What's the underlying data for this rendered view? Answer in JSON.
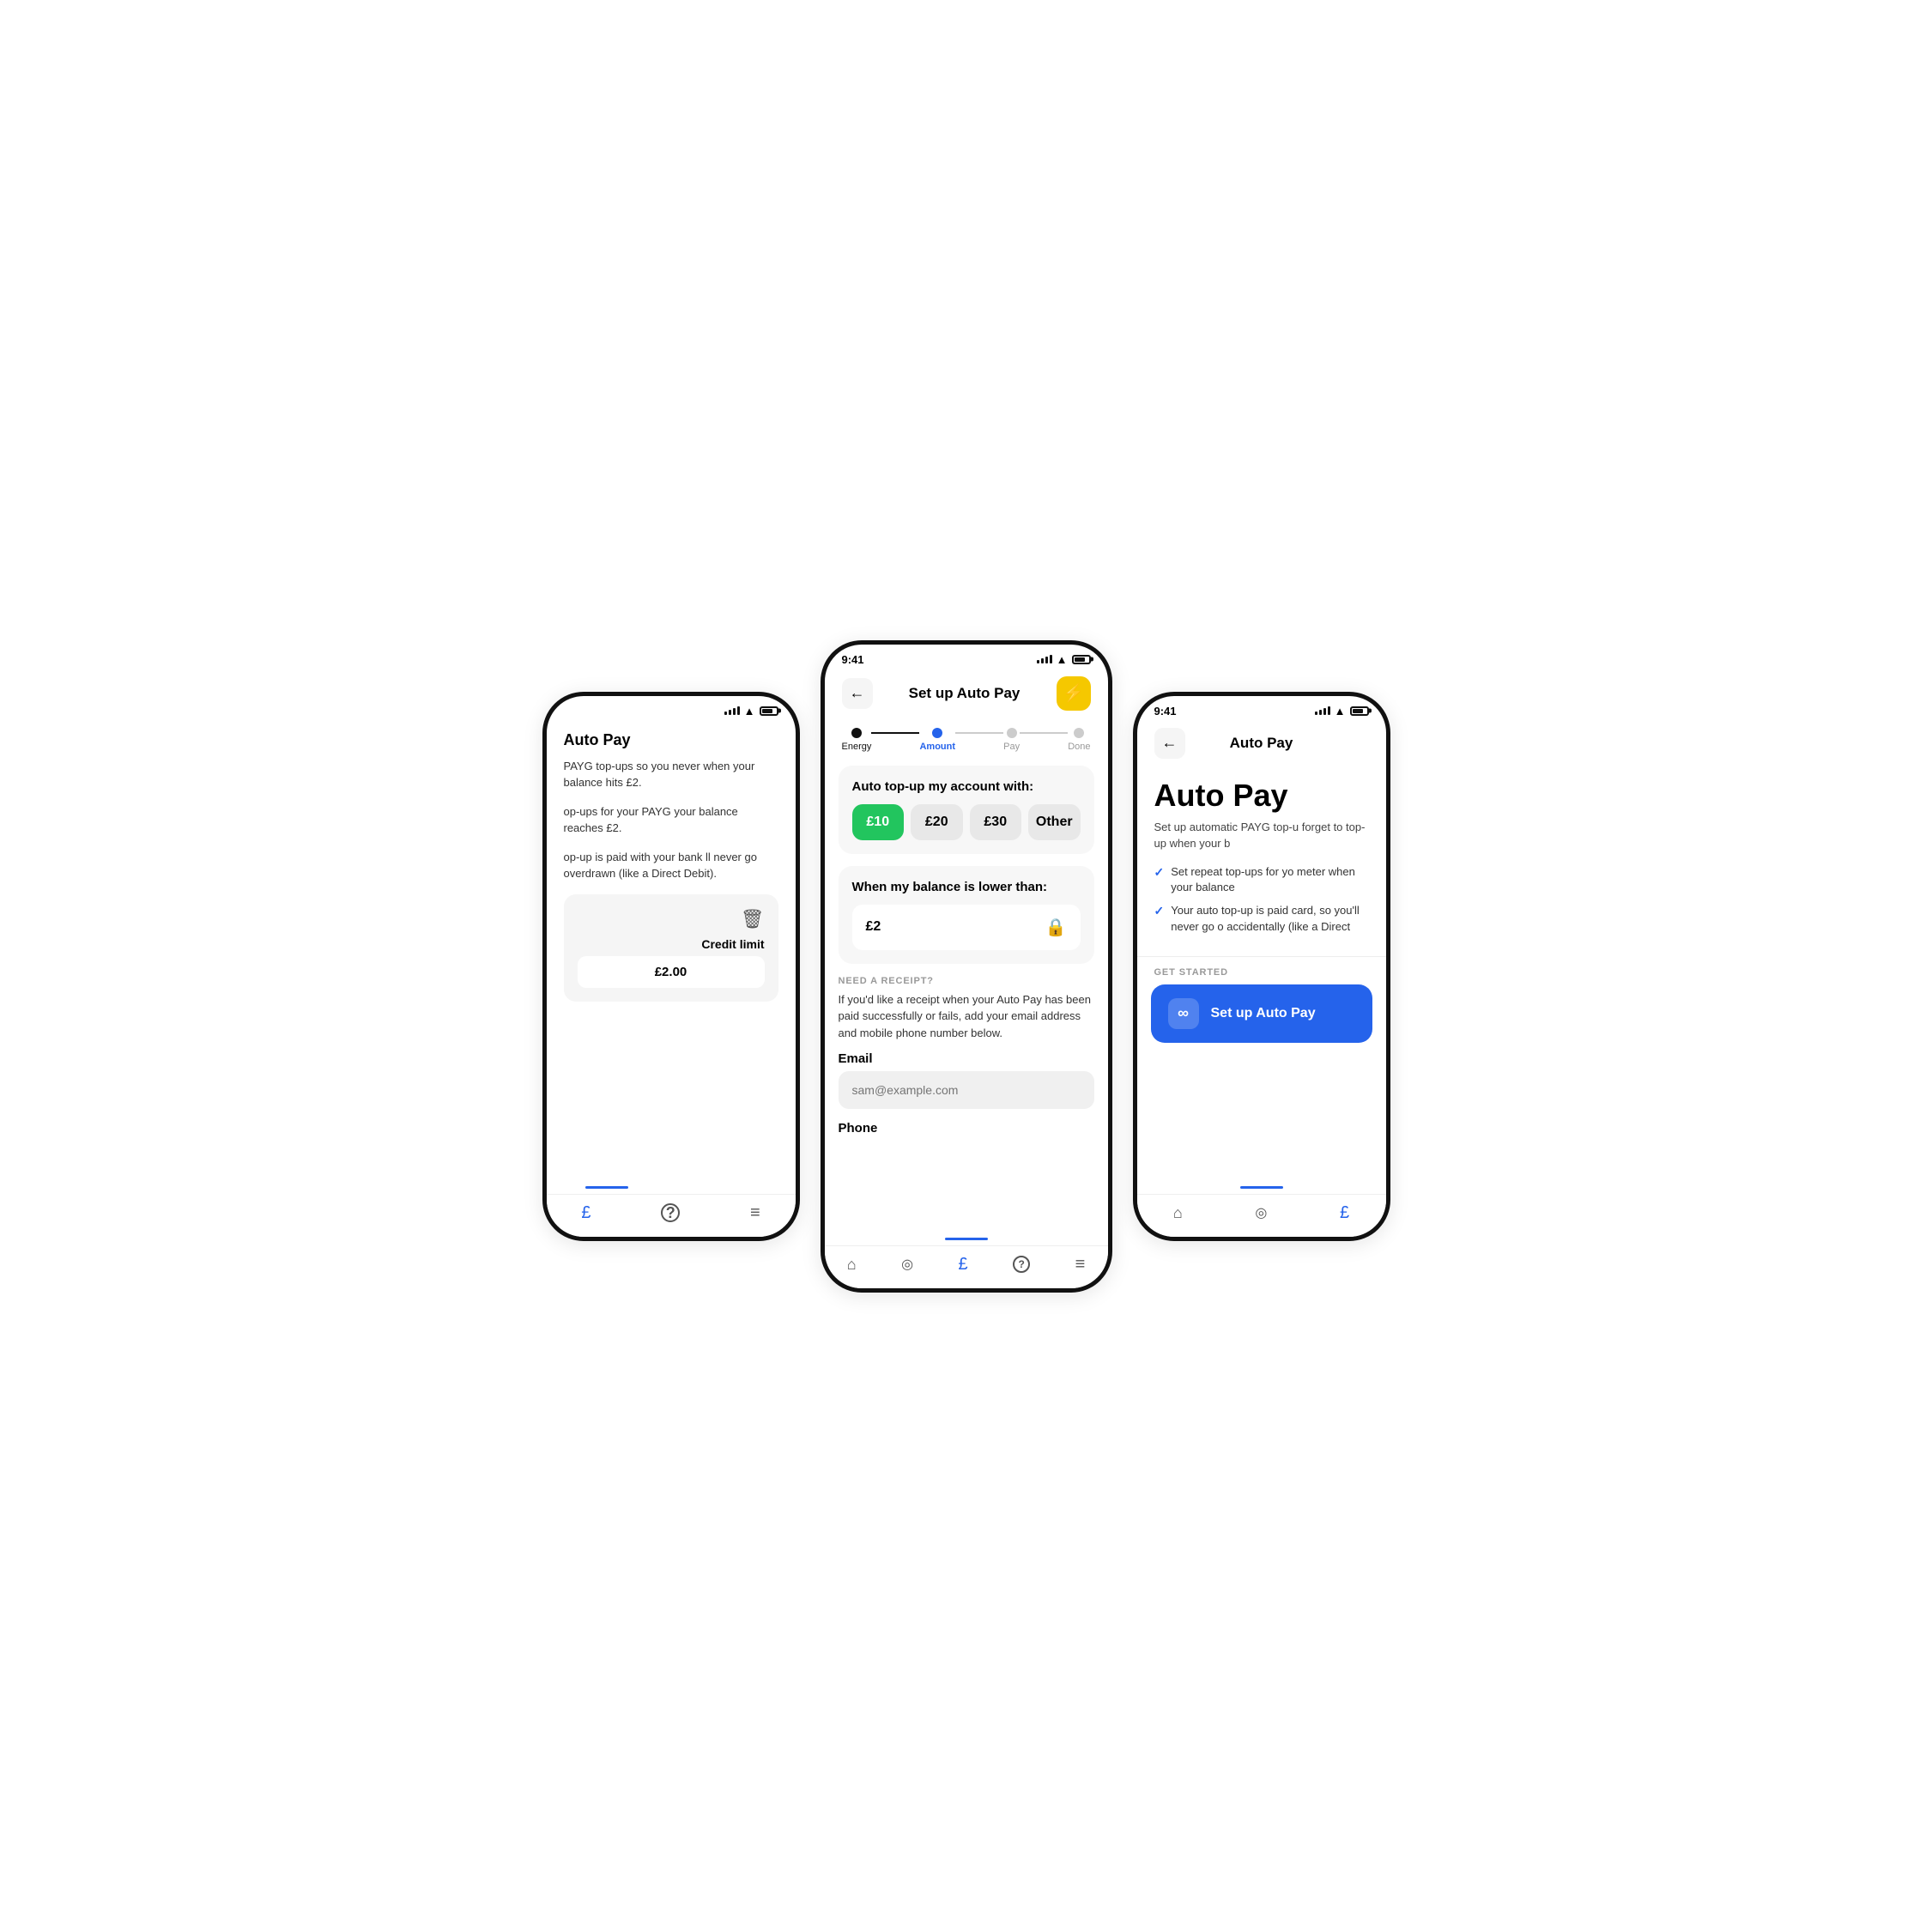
{
  "left_phone": {
    "title": "Auto Pay",
    "description1": "PAYG top-ups so you never when your balance hits £2.",
    "description2": "op-ups for your PAYG your balance reaches £2.",
    "description3": "op-up is paid with your bank ll never go overdrawn (like a Direct Debit).",
    "credit_limit_label": "Credit limit",
    "credit_amount": "£2.00",
    "tabs": [
      "£",
      "?",
      "≡"
    ]
  },
  "center_phone": {
    "status_time": "9:41",
    "nav_back_label": "←",
    "nav_title": "Set up Auto Pay",
    "stepper": {
      "steps": [
        {
          "label": "Energy",
          "state": "done"
        },
        {
          "label": "Amount",
          "state": "active"
        },
        {
          "label": "Pay",
          "state": "inactive"
        },
        {
          "label": "Done",
          "state": "inactive"
        }
      ]
    },
    "auto_topup_card": {
      "title": "Auto top-up my account with:",
      "options": [
        {
          "label": "£10",
          "selected": true
        },
        {
          "label": "£20",
          "selected": false
        },
        {
          "label": "£30",
          "selected": false
        },
        {
          "label": "Other",
          "selected": false
        }
      ]
    },
    "balance_card": {
      "title": "When my balance is lower than:",
      "value": "£2"
    },
    "receipt_section": {
      "label": "NEED A RECEIPT?",
      "text": "If you'd like a receipt when your Auto Pay has been paid successfully or fails, add your email address and mobile phone number below."
    },
    "email_field": {
      "label": "Email",
      "placeholder": "sam@example.com"
    },
    "phone_field": {
      "label": "Phone",
      "placeholder": ""
    },
    "tabs": [
      "🏠",
      "⌀",
      "£",
      "?",
      "≡"
    ]
  },
  "right_phone": {
    "status_time": "9:41",
    "nav_back_label": "←",
    "nav_title": "Auto Pay",
    "hero_title": "Auto Pay",
    "hero_subtitle": "Set up automatic PAYG top-u forget to top-up when your b",
    "checklist": [
      "Set repeat top-ups for yo meter when your balance",
      "Your auto top-up is paid card, so you'll never go o accidentally (like a Direct"
    ],
    "get_started_label": "GET STARTED",
    "setup_btn_label": "Set up Auto Pay",
    "tabs": [
      "🏠",
      "⌀",
      "£"
    ]
  },
  "icons": {
    "back_arrow": "←",
    "lightning": "⚡",
    "lock": "🔒",
    "trash": "🗑",
    "infinity": "∞",
    "home": "⌂",
    "usage": "◉",
    "account": "£",
    "help": "?",
    "menu": "≡",
    "check": "✓"
  }
}
